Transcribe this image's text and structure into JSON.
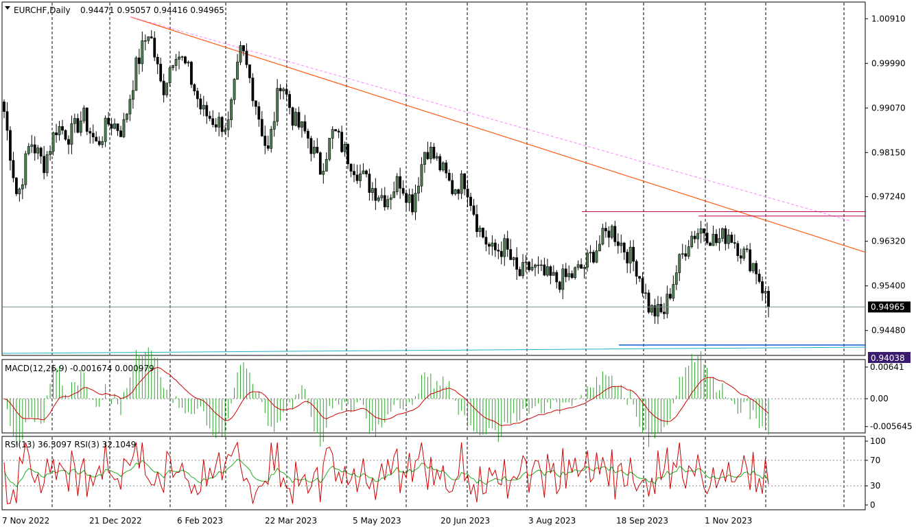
{
  "chart_data": [
    {
      "type": "candlestick",
      "symbol": "EURCHF,Daily",
      "ohlc_label": "0.94471 0.95057 0.94416 0.94965",
      "price_ticks": [
        "1.00910",
        "0.99990",
        "0.99070",
        "0.98150",
        "0.97240",
        "0.96320",
        "0.95400",
        "0.94480"
      ],
      "ylim": [
        0.9398,
        1.0124
      ],
      "current_price": "0.94965",
      "secondary_price": "0.94038",
      "x_labels": [
        "7 Nov 2022",
        "21 Dec 2022",
        "6 Feb 2023",
        "22 Mar 2023",
        "5 May 2023",
        "20 Jun 2023",
        "3 Aug 2023",
        "18 Sep 2023",
        "1 Nov 2023"
      ],
      "series_close_approx": [
        0.99,
        0.972,
        0.984,
        0.979,
        0.987,
        0.985,
        0.989,
        0.983,
        0.988,
        0.986,
        0.999,
        1.007,
        0.994,
        1.003,
        0.998,
        0.99,
        0.988,
        0.987,
        1.003,
        0.993,
        0.981,
        0.997,
        0.988,
        0.985,
        0.978,
        0.986,
        0.981,
        0.977,
        0.974,
        0.972,
        0.976,
        0.971,
        0.983,
        0.979,
        0.974,
        0.976,
        0.966,
        0.961,
        0.962,
        0.956,
        0.958,
        0.956,
        0.955,
        0.956,
        0.958,
        0.962,
        0.966,
        0.962,
        0.958,
        0.949,
        0.948,
        0.957,
        0.964,
        0.966,
        0.963,
        0.965,
        0.961,
        0.958,
        0.95
      ],
      "colors": {
        "bull": "#5a5a5a",
        "bear": "#000000",
        "trend": "#ff5a14",
        "trend_dashed": "#ff80ff",
        "resistance": "#c00050",
        "support": "#0a5fd0",
        "cyan": "#20b0c8"
      }
    },
    {
      "type": "bar",
      "title": "MACD(12,26,9) -0.001674 0.000979",
      "ticks": [
        "0.00641",
        "0.00",
        "-0.005645"
      ],
      "ylim": [
        -0.0068,
        0.0078
      ],
      "histogram_color": "#2aa12a",
      "signal_color": "#cc0000"
    },
    {
      "type": "line",
      "title": "RSI(13) 36.3097  RSI(3) 32.1049",
      "ticks": [
        "100",
        "70",
        "30",
        "0"
      ],
      "ylim": [
        0,
        100
      ],
      "rsi13_color": "#22aa22",
      "rsi3_color": "#cc0000"
    }
  ]
}
